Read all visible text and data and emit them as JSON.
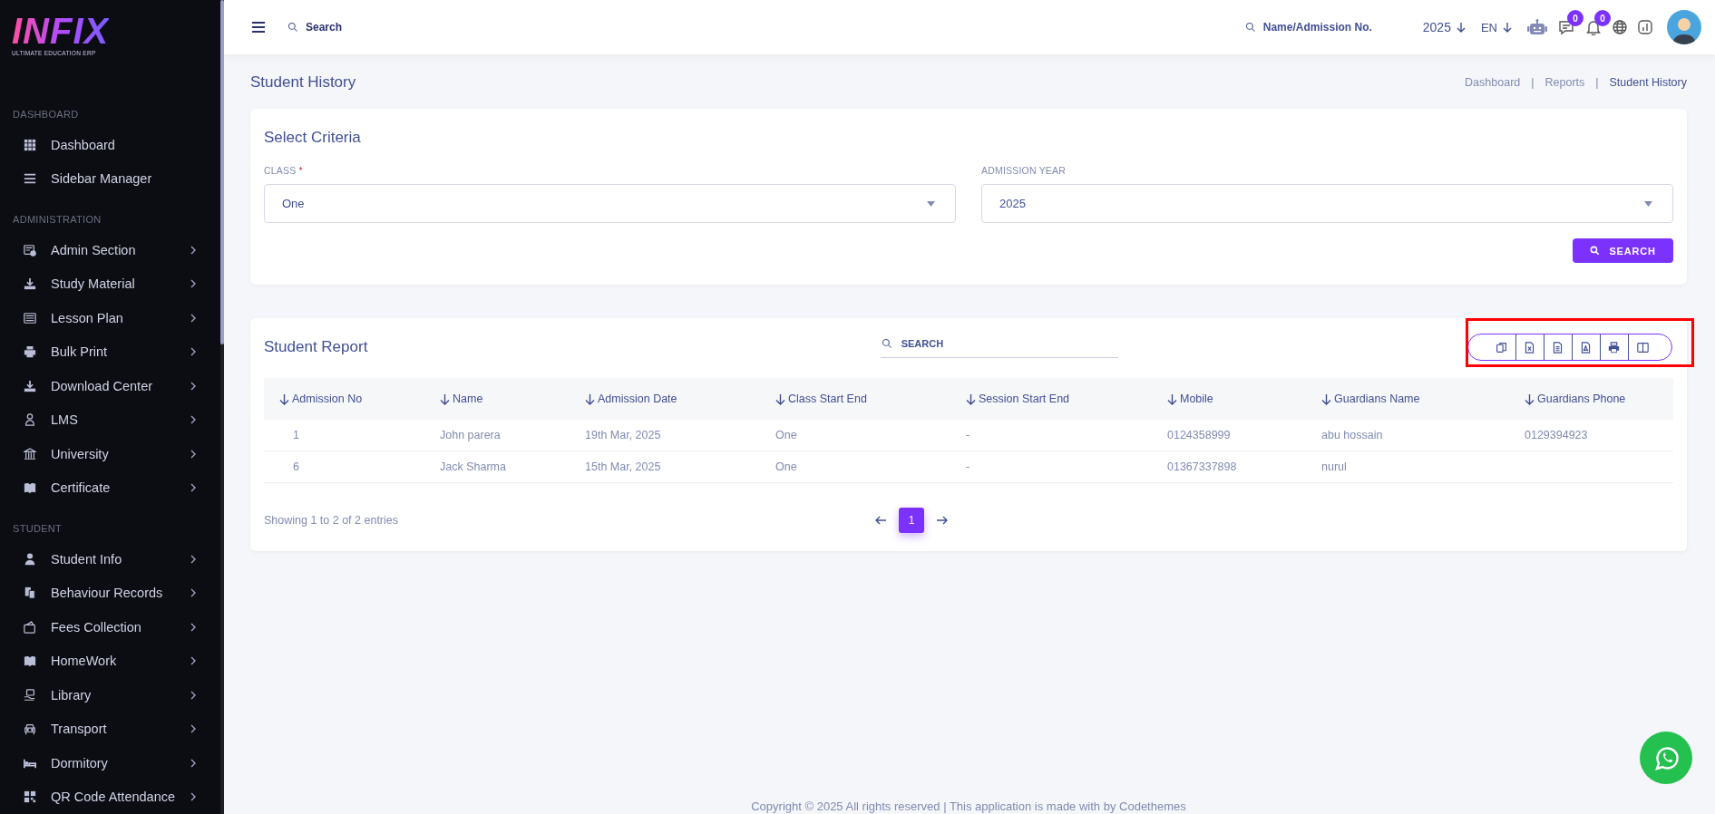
{
  "sidebar": {
    "logo": {
      "text": "INFIX",
      "tagline": "ULTIMATE EDUCATION ERP"
    },
    "sections": [
      {
        "title": "DASHBOARD",
        "items": [
          {
            "label": "Dashboard",
            "has_submenu": false
          },
          {
            "label": "Sidebar Manager",
            "has_submenu": false
          }
        ]
      },
      {
        "title": "ADMINISTRATION",
        "items": [
          {
            "label": "Admin Section",
            "has_submenu": true
          },
          {
            "label": "Study Material",
            "has_submenu": true
          },
          {
            "label": "Lesson Plan",
            "has_submenu": true
          },
          {
            "label": "Bulk Print",
            "has_submenu": true
          },
          {
            "label": "Download Center",
            "has_submenu": true
          },
          {
            "label": "LMS",
            "has_submenu": true
          },
          {
            "label": "University",
            "has_submenu": true
          },
          {
            "label": "Certificate",
            "has_submenu": true
          }
        ]
      },
      {
        "title": "STUDENT",
        "items": [
          {
            "label": "Student Info",
            "has_submenu": true
          },
          {
            "label": "Behaviour Records",
            "has_submenu": true
          },
          {
            "label": "Fees Collection",
            "has_submenu": true
          },
          {
            "label": "HomeWork",
            "has_submenu": true
          },
          {
            "label": "Library",
            "has_submenu": true
          },
          {
            "label": "Transport",
            "has_submenu": true
          },
          {
            "label": "Dormitory",
            "has_submenu": true
          },
          {
            "label": "QR Code Attendance",
            "has_submenu": true
          }
        ]
      }
    ]
  },
  "header": {
    "search": {
      "placeholder": "Search"
    },
    "student_search": {
      "placeholder": "Name/Admission No."
    },
    "year": "2025",
    "language": "EN",
    "messages_badge": "0",
    "notifications_badge": "0"
  },
  "page": {
    "title": "Student History",
    "breadcrumb_separator": "|",
    "breadcrumb": [
      {
        "label": "Dashboard",
        "current": false
      },
      {
        "label": "Reports",
        "current": false
      },
      {
        "label": "Student History",
        "current": true
      }
    ]
  },
  "criteria": {
    "title": "Select Criteria",
    "fields": [
      {
        "label": "CLASS",
        "required_mark": "*",
        "value": "One"
      },
      {
        "label": "ADMISSION YEAR",
        "value": "2025"
      }
    ],
    "search_button": "SEARCH"
  },
  "report": {
    "title": "Student Report",
    "search": {
      "placeholder": "SEARCH"
    },
    "export_buttons": [
      {
        "kind": "copy"
      },
      {
        "kind": "excel"
      },
      {
        "kind": "csv"
      },
      {
        "kind": "pdf"
      },
      {
        "kind": "print"
      },
      {
        "kind": "columns"
      }
    ],
    "columns": [
      "Admission No",
      "Name",
      "Admission Date",
      "Class Start End",
      "Session Start End",
      "Mobile",
      "Guardians Name",
      "Guardians Phone"
    ],
    "rows": [
      [
        "1",
        "John parera",
        "19th Mar, 2025",
        "One",
        "-",
        "0124358999",
        "abu hossain",
        "0129394923"
      ],
      [
        "6",
        "Jack Sharma",
        "15th Mar, 2025",
        "One",
        "-",
        "01367337898",
        "nurul"
      ]
    ],
    "summary": "Showing 1 to 2 of 2 entries",
    "pages": [
      {
        "label": "1",
        "selected": true
      }
    ]
  },
  "footer": "Copyright © 2025 All rights reserved | This application is made with by Codethemes"
}
